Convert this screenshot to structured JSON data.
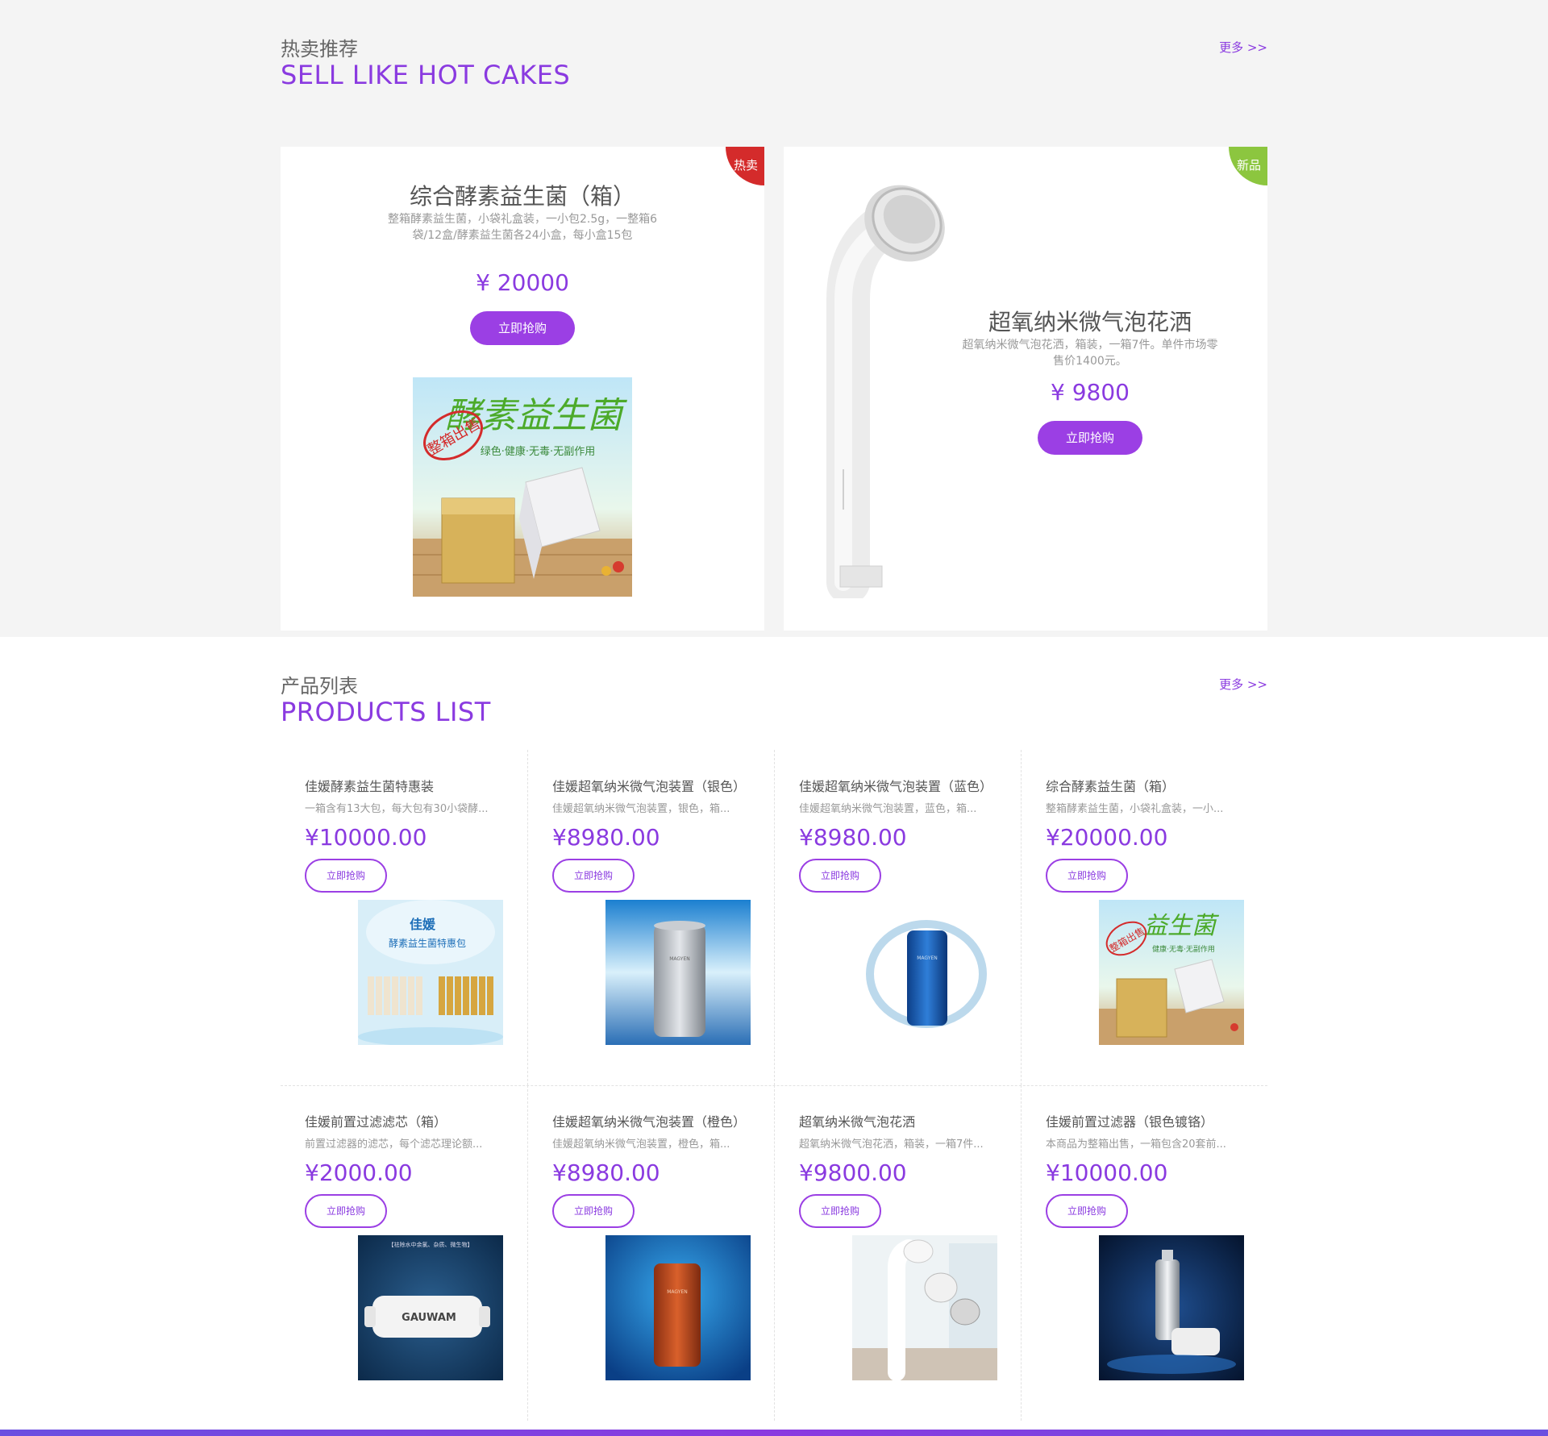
{
  "hot": {
    "title_zh": "热卖推荐",
    "title_en": "SELL LIKE HOT CAKES",
    "more": "更多 >>",
    "cards": [
      {
        "badge": "热卖",
        "badge_color": "#d42b2b",
        "name": "综合酵素益生菌（箱）",
        "desc": "整箱酵素益生菌，小袋礼盒装，一小包2.5g，一整箱6袋/12盒/酵素益生菌各24小盒，每小盒15包",
        "price": "¥ 20000",
        "btn": "立即抢购",
        "image_icon": "probiotic-box-photo",
        "image_text": "酵素益生菌",
        "image_stamp": "整箱出售",
        "image_slogan": "绿色·健康·无毒·无副作用"
      },
      {
        "badge": "新品",
        "badge_color": "#8cc63f",
        "name": "超氧纳米微气泡花洒",
        "desc": "超氧纳米微气泡花洒，箱装，一箱7件。单件市场零售价1400元。",
        "price": "¥ 9800",
        "btn": "立即抢购",
        "image_icon": "shower-head-photo"
      }
    ]
  },
  "products": {
    "title_zh": "产品列表",
    "title_en": "PRODUCTS LIST",
    "more": "更多 >>",
    "items": [
      {
        "name": "佳媛酵素益生菌特惠装",
        "desc": "一箱含有13大包，每大包有30小袋酵...",
        "price": "¥10000.00",
        "btn": "立即抢购",
        "image_icon": "probiotic-pack-photo",
        "image_text": "酵素益生菌特惠包",
        "image_logo": "佳媛"
      },
      {
        "name": "佳媛超氧纳米微气泡装置（银色）",
        "desc": "佳媛超氧纳米微气泡装置，银色，箱...",
        "price": "¥8980.00",
        "btn": "立即抢购",
        "image_icon": "silver-device-photo",
        "image_logo": "MAGYEN"
      },
      {
        "name": "佳媛超氧纳米微气泡装置（蓝色）",
        "desc": "佳媛超氧纳米微气泡装置，蓝色，箱...",
        "price": "¥8980.00",
        "btn": "立即抢购",
        "image_icon": "blue-device-photo",
        "image_logo": "MAGYEN"
      },
      {
        "name": "综合酵素益生菌（箱）",
        "desc": "整箱酵素益生菌，小袋礼盒装，一小...",
        "price": "¥20000.00",
        "btn": "立即抢购",
        "image_icon": "probiotic-box-photo",
        "image_text": "益生菌",
        "image_stamp": "整箱出售",
        "image_slogan": "健康·无毒·无副作用"
      },
      {
        "name": "佳媛前置过滤滤芯（箱）",
        "desc": "前置过滤器的滤芯，每个滤芯理论额...",
        "price": "¥2000.00",
        "btn": "立即抢购",
        "image_icon": "filter-cartridge-photo",
        "image_logo": "GAUWAM",
        "image_text": "【祛除水中余氯、杂质、微生物】"
      },
      {
        "name": "佳媛超氧纳米微气泡装置（橙色）",
        "desc": "佳媛超氧纳米微气泡装置，橙色，箱...",
        "price": "¥8980.00",
        "btn": "立即抢购",
        "image_icon": "orange-device-photo",
        "image_logo": "MAGYEN"
      },
      {
        "name": "超氧纳米微气泡花洒",
        "desc": "超氧纳米微气泡花洒，箱装，一箱7件...",
        "price": "¥9800.00",
        "btn": "立即抢购",
        "image_icon": "shower-head-photo"
      },
      {
        "name": "佳媛前置过滤器（银色镀铬）",
        "desc": "本商品为整箱出售，一箱包含20套前...",
        "price": "¥10000.00",
        "btn": "立即抢购",
        "image_icon": "chrome-filter-photo"
      }
    ]
  },
  "colors": {
    "accent": "#8a3ae0",
    "button": "#9b3fe4",
    "hot_badge": "#d42b2b",
    "new_badge": "#8cc63f"
  }
}
